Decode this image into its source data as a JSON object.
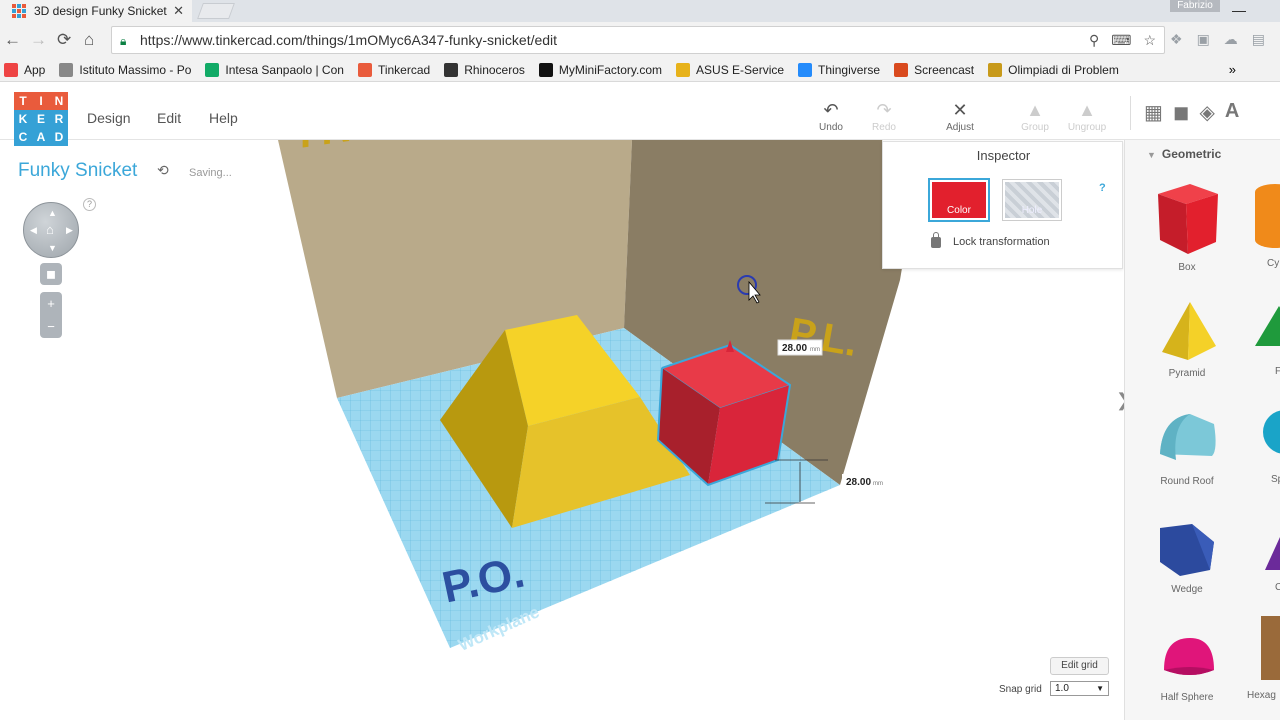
{
  "browser": {
    "tab_title": "3D design Funky Snicket",
    "tab_close": "✕",
    "user_name": "Fabrizio",
    "url": "https://www.tinkercad.com/things/1mOMyc6A347-funky-snicket/edit",
    "bookmarks": [
      {
        "label": "App",
        "icon": "apps-grid-icon",
        "color": "#e44"
      },
      {
        "label": "Istituto Massimo - Po",
        "icon": "globe-icon",
        "color": "#888"
      },
      {
        "label": "Intesa Sanpaolo | Con",
        "icon": "bank-icon",
        "color": "#1a6"
      },
      {
        "label": "Tinkercad",
        "icon": "tinkercad-icon",
        "color": "#e95b3c"
      },
      {
        "label": "Rhinoceros",
        "icon": "rhino-icon",
        "color": "#333"
      },
      {
        "label": "MyMiniFactory.com",
        "icon": "mmf-icon",
        "color": "#111"
      },
      {
        "label": "ASUS E-Service",
        "icon": "folder-icon",
        "color": "#e7b21a"
      },
      {
        "label": "Thingiverse",
        "icon": "thingiverse-icon",
        "color": "#248bfb"
      },
      {
        "label": "Screencast",
        "icon": "screencast-icon",
        "color": "#d94a1e"
      },
      {
        "label": "Olimpiadi di Problem",
        "icon": "olympics-icon",
        "color": "#c89a1a"
      }
    ],
    "bookmarks_more": "»"
  },
  "app": {
    "logo_letters": [
      "T",
      "I",
      "N",
      "K",
      "E",
      "R",
      "C",
      "A",
      "D"
    ],
    "logo_colors": [
      "#e95b3c",
      "#e95b3c",
      "#e95b3c",
      "#35a1d6",
      "#35a1d6",
      "#35a1d6",
      "#35a1d6",
      "#35a1d6",
      "#35a1d6"
    ],
    "menu": {
      "design": "Design",
      "edit": "Edit",
      "help": "Help"
    },
    "tools": {
      "undo": "Undo",
      "redo": "Redo",
      "adjust": "Adjust",
      "group": "Group",
      "ungroup": "Ungroup"
    },
    "design_title": "Funky Snicket",
    "saving_status": "Saving..."
  },
  "viewport": {
    "wall_left_label": "P.V.",
    "wall_right_label": "P.L.",
    "floor_label": "P.O.",
    "workplane_label": "Workplane",
    "dim_top": "28.00",
    "dim_side": "28.00",
    "dim_unit": "mm",
    "colors": {
      "pyramid": "#e6c22a",
      "box": "#d9253a",
      "workplane": "#8fd3ef",
      "walls": "#b8a98a"
    }
  },
  "inspector": {
    "title": "Inspector",
    "color_label": "Color",
    "hole_label": "Hole",
    "help": "?",
    "lock_label": "Lock transformation",
    "selected_color": "#e2202d"
  },
  "grid": {
    "edit_label": "Edit grid",
    "snap_label": "Snap grid",
    "snap_value": "1.0"
  },
  "shapes": {
    "category": "Geometric",
    "items": [
      {
        "label": "Box"
      },
      {
        "label": "Pyramid"
      },
      {
        "label": "Round Roof"
      },
      {
        "label": "Wedge"
      },
      {
        "label": "Half Sphere"
      }
    ],
    "right_column_partial": [
      "Cy",
      "F",
      "Sp",
      "C",
      "Hexag"
    ]
  }
}
